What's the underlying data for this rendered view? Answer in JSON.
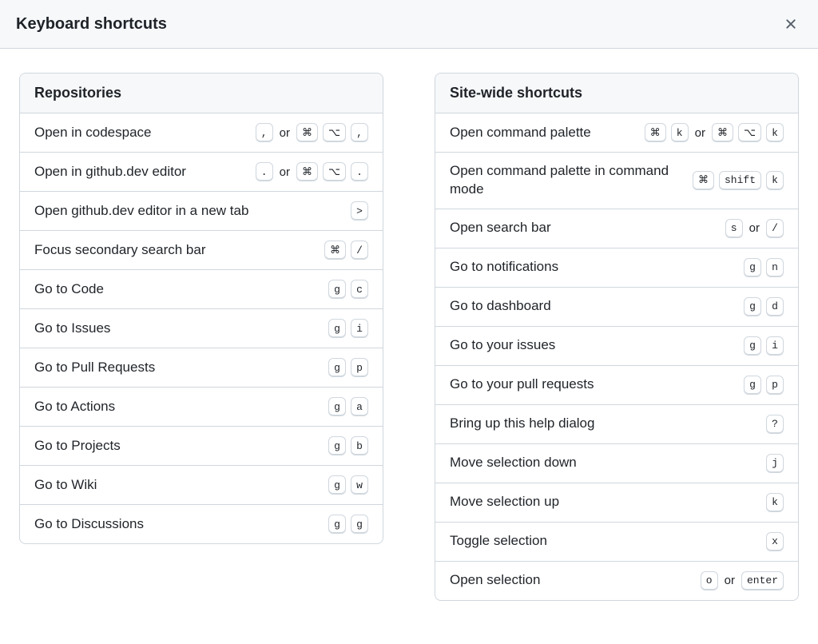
{
  "title": "Keyboard shortcuts",
  "or_label": "or",
  "sections": [
    {
      "id": "repositories",
      "title": "Repositories",
      "column": 0,
      "rows": [
        {
          "label": "Open in codespace",
          "keys": [
            [
              ","
            ],
            [
              "⌘",
              "⌥",
              ","
            ]
          ]
        },
        {
          "label": "Open in github.dev editor",
          "keys": [
            [
              "."
            ],
            [
              "⌘",
              "⌥",
              "."
            ]
          ]
        },
        {
          "label": "Open github.dev editor in a new tab",
          "keys": [
            [
              ">"
            ]
          ]
        },
        {
          "label": "Focus secondary search bar",
          "keys": [
            [
              "⌘",
              "/"
            ]
          ]
        },
        {
          "label": "Go to Code",
          "keys": [
            [
              "g",
              "c"
            ]
          ]
        },
        {
          "label": "Go to Issues",
          "keys": [
            [
              "g",
              "i"
            ]
          ]
        },
        {
          "label": "Go to Pull Requests",
          "keys": [
            [
              "g",
              "p"
            ]
          ]
        },
        {
          "label": "Go to Actions",
          "keys": [
            [
              "g",
              "a"
            ]
          ]
        },
        {
          "label": "Go to Projects",
          "keys": [
            [
              "g",
              "b"
            ]
          ]
        },
        {
          "label": "Go to Wiki",
          "keys": [
            [
              "g",
              "w"
            ]
          ]
        },
        {
          "label": "Go to Discussions",
          "keys": [
            [
              "g",
              "g"
            ]
          ]
        }
      ]
    },
    {
      "id": "sitewide",
      "title": "Site-wide shortcuts",
      "column": 1,
      "rows": [
        {
          "label": "Open command palette",
          "keys": [
            [
              "⌘",
              "k"
            ],
            [
              "⌘",
              "⌥",
              "k"
            ]
          ]
        },
        {
          "label": "Open command palette in command mode",
          "keys": [
            [
              "⌘",
              "shift",
              "k"
            ]
          ]
        },
        {
          "label": "Open search bar",
          "keys": [
            [
              "s"
            ],
            [
              "/"
            ]
          ]
        },
        {
          "label": "Go to notifications",
          "keys": [
            [
              "g",
              "n"
            ]
          ]
        },
        {
          "label": "Go to dashboard",
          "keys": [
            [
              "g",
              "d"
            ]
          ]
        },
        {
          "label": "Go to your issues",
          "keys": [
            [
              "g",
              "i"
            ]
          ]
        },
        {
          "label": "Go to your pull requests",
          "keys": [
            [
              "g",
              "p"
            ]
          ]
        },
        {
          "label": "Bring up this help dialog",
          "keys": [
            [
              "?"
            ]
          ]
        },
        {
          "label": "Move selection down",
          "keys": [
            [
              "j"
            ]
          ]
        },
        {
          "label": "Move selection up",
          "keys": [
            [
              "k"
            ]
          ]
        },
        {
          "label": "Toggle selection",
          "keys": [
            [
              "x"
            ]
          ]
        },
        {
          "label": "Open selection",
          "keys": [
            [
              "o"
            ],
            [
              "enter"
            ]
          ]
        }
      ]
    }
  ]
}
